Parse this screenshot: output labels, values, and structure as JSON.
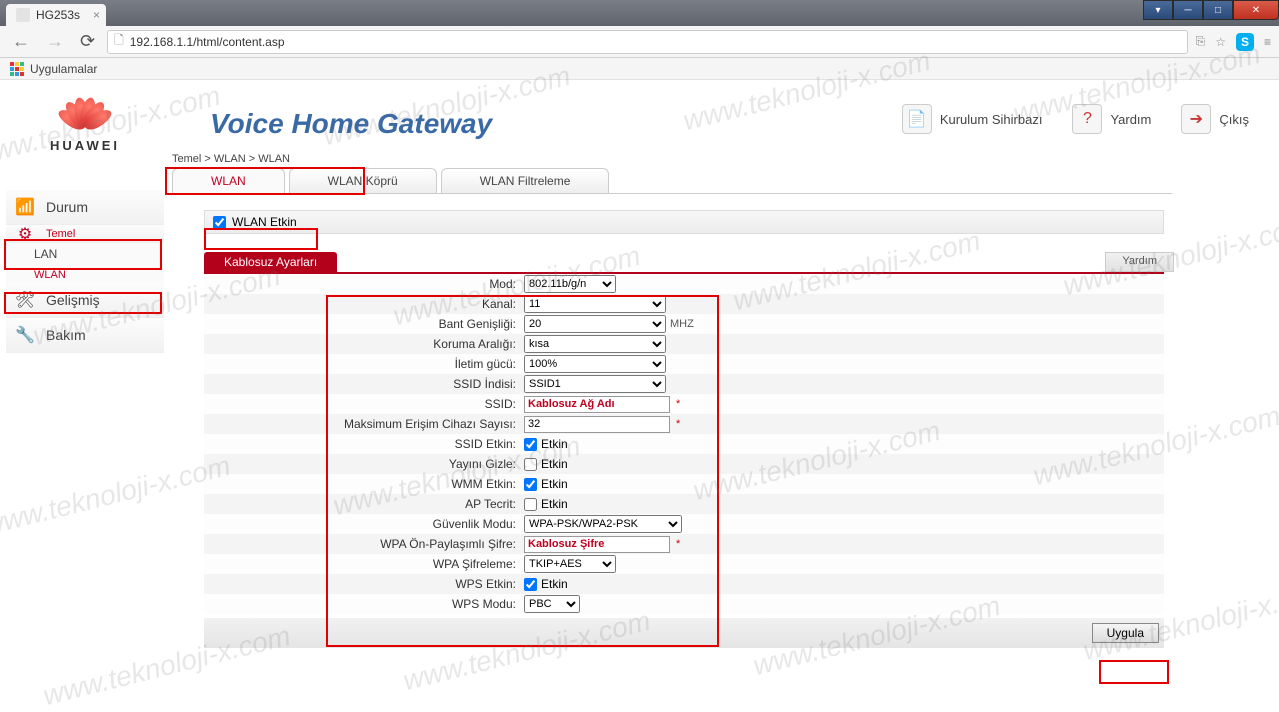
{
  "browser": {
    "tab_title": "HG253s",
    "url": "192.168.1.1/html/content.asp",
    "bookmarks_label": "Uygulamalar"
  },
  "header": {
    "brand": "HUAWEI",
    "title": "Voice Home Gateway",
    "actions": {
      "wizard": "Kurulum Sihirbazı",
      "help": "Yardım",
      "logout": "Çıkış"
    }
  },
  "breadcrumb": "Temel > WLAN > WLAN",
  "tabs": {
    "wlan": "WLAN",
    "bridge": "WLAN Köprü",
    "filter": "WLAN Filtreleme"
  },
  "sidebar": {
    "status": "Durum",
    "basic": "Temel",
    "lan": "LAN",
    "wlan": "WLAN",
    "advanced": "Gelişmiş",
    "maintenance": "Bakım"
  },
  "wlan_enable_label": "WLAN Etkin",
  "section": {
    "title": "Kablosuz Ayarları",
    "help": "Yardım"
  },
  "form": {
    "mode": {
      "label": "Mod:",
      "value": "802.11b/g/n"
    },
    "channel": {
      "label": "Kanal:",
      "value": "11"
    },
    "bandwidth": {
      "label": "Bant Genişliği:",
      "value": "20",
      "unit": "MHZ"
    },
    "guard": {
      "label": "Koruma Aralığı:",
      "value": "kısa"
    },
    "txpower": {
      "label": "İletim gücü:",
      "value": "100%"
    },
    "ssid_index": {
      "label": "SSID İndisi:",
      "value": "SSID1"
    },
    "ssid": {
      "label": "SSID:",
      "value": "Kablosuz Ağ Adı"
    },
    "max_clients": {
      "label": "Maksimum Erişim Cihazı Sayısı:",
      "value": "32"
    },
    "ssid_enable": {
      "label": "SSID Etkin:",
      "text": "Etkin",
      "checked": true
    },
    "hide_broadcast": {
      "label": "Yayını Gizle:",
      "text": "Etkin",
      "checked": false
    },
    "wmm": {
      "label": "WMM Etkin:",
      "text": "Etkin",
      "checked": true
    },
    "ap_isolate": {
      "label": "AP Tecrit:",
      "text": "Etkin",
      "checked": false
    },
    "security": {
      "label": "Güvenlik Modu:",
      "value": "WPA-PSK/WPA2-PSK"
    },
    "wpa_psk": {
      "label": "WPA Ön-Paylaşımlı Şifre:",
      "value": "Kablosuz Şifre"
    },
    "wpa_enc": {
      "label": "WPA Şifreleme:",
      "value": "TKIP+AES"
    },
    "wps_enable": {
      "label": "WPS Etkin:",
      "text": "Etkin",
      "checked": true
    },
    "wps_mode": {
      "label": "WPS Modu:",
      "value": "PBC"
    }
  },
  "apply": "Uygula",
  "watermark": "www.teknoloji-x.com"
}
